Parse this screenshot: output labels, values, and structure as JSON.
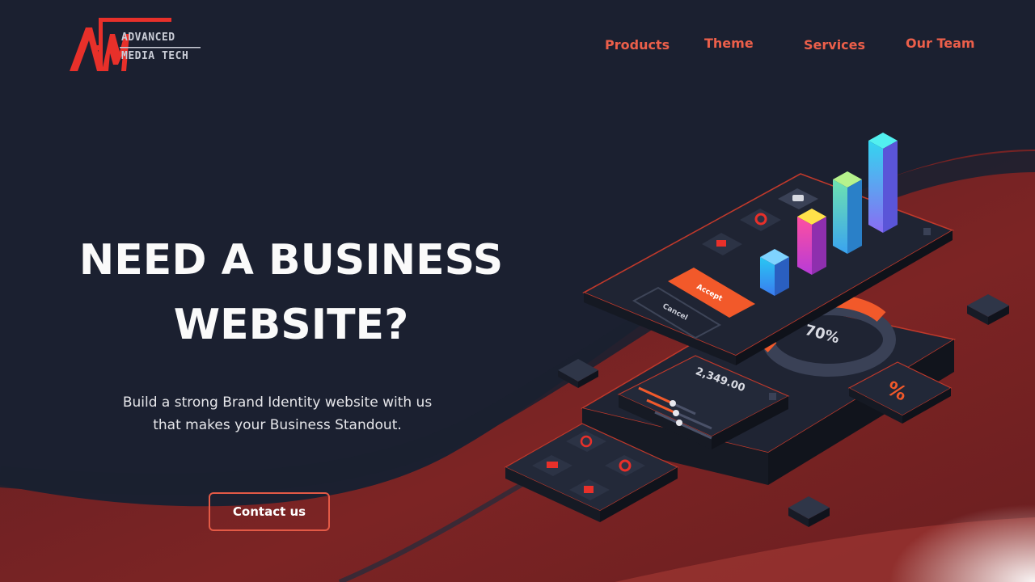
{
  "brand": {
    "logo_text": "AMT",
    "name_line1": "ADVANCED",
    "name_line2": "MEDIA TECH",
    "accent": "#e8302a"
  },
  "nav": {
    "items": [
      {
        "label": "Products"
      },
      {
        "label": "Theme"
      },
      {
        "label": "Services"
      },
      {
        "label": "Our Team"
      }
    ],
    "color": "#ec5f4a"
  },
  "hero": {
    "title_line1": "NEED A BUSINESS",
    "title_line2": "WEBSITE?",
    "subtitle_line1": "Build a strong Brand Identity website with us",
    "subtitle_line2": "that makes your Business Standout.",
    "cta_label": "Contact us"
  },
  "illustration": {
    "accept_label": "Accept",
    "cancel_label": "Cancel",
    "donut_label": "70%",
    "amount_label": "2,349.00",
    "percent_symbol": "%",
    "icons": [
      "video-icon",
      "location-pin-icon",
      "chat-icon",
      "phone-icon",
      "settings-icon",
      "camera-icon",
      "clipboard-icon"
    ]
  },
  "colors": {
    "background": "#1b2030",
    "wave": "#7a2323",
    "card": "#252b3a",
    "orange": "#f2592a"
  }
}
